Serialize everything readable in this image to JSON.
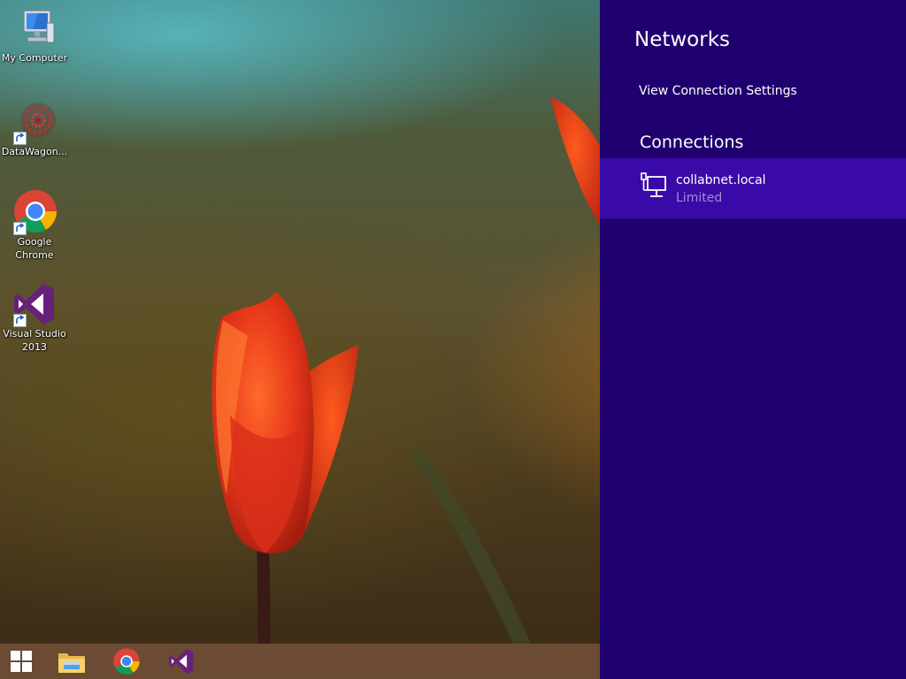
{
  "desktop": {
    "icons": [
      {
        "label": "My Computer",
        "icon": "computer-icon"
      },
      {
        "label": "DataWagon...",
        "icon": "datawagon-icon"
      },
      {
        "label": "Google Chrome",
        "icon": "chrome-icon"
      },
      {
        "label": "Visual Studio 2013",
        "icon": "visual-studio-icon"
      }
    ]
  },
  "taskbar": {
    "items": [
      {
        "icon": "windows-start-icon"
      },
      {
        "icon": "file-explorer-icon"
      },
      {
        "icon": "chrome-icon"
      },
      {
        "icon": "visual-studio-icon"
      }
    ]
  },
  "network_panel": {
    "title": "Networks",
    "view_settings_link": "View Connection Settings",
    "connections_header": "Connections",
    "connections": [
      {
        "name": "collabnet.local",
        "status": "Limited",
        "icon": "wired-network-icon"
      }
    ],
    "colors": {
      "panel_background": "#20006f",
      "selected_item": "#3a0aa8",
      "status_text": "#9c8fd2"
    }
  }
}
